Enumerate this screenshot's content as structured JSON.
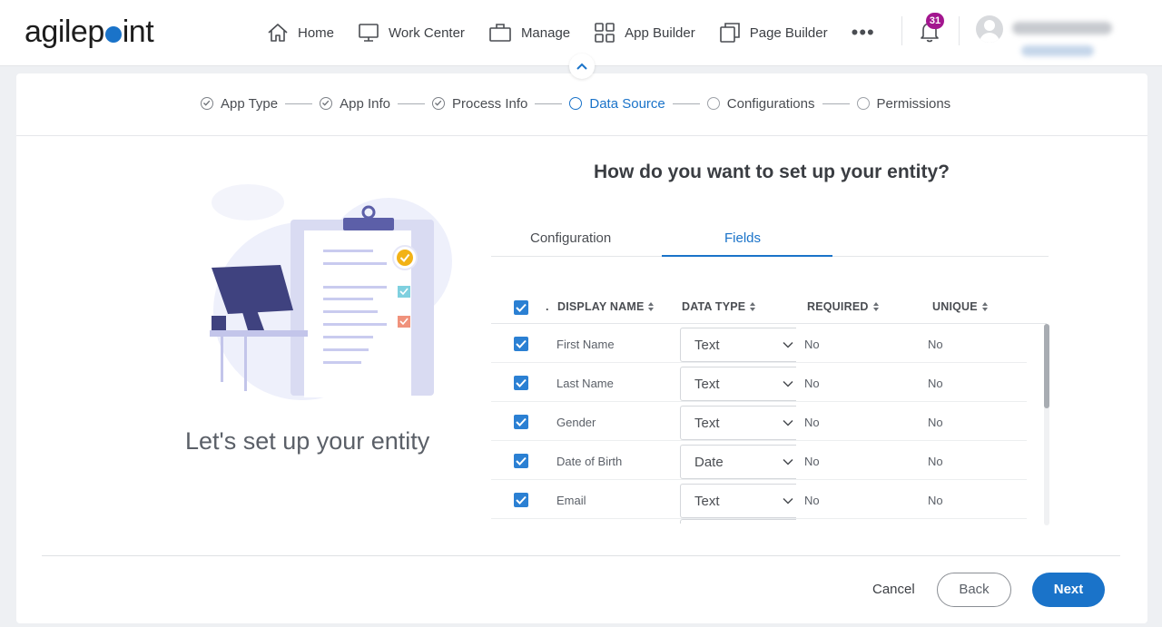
{
  "brand": {
    "logo_pre": "agilep",
    "logo_post": "int",
    "accent": "#1a73c9"
  },
  "nav": {
    "items": [
      {
        "label": "Home",
        "icon": "home-icon"
      },
      {
        "label": "Work Center",
        "icon": "monitor-icon"
      },
      {
        "label": "Manage",
        "icon": "briefcase-icon"
      },
      {
        "label": "App Builder",
        "icon": "grid-icon"
      },
      {
        "label": "Page Builder",
        "icon": "pages-icon"
      }
    ],
    "more": "•••",
    "notifications": "31"
  },
  "steps": [
    {
      "label": "App Type",
      "state": "done"
    },
    {
      "label": "App Info",
      "state": "done"
    },
    {
      "label": "Process Info",
      "state": "done"
    },
    {
      "label": "Data Source",
      "state": "active"
    },
    {
      "label": "Configurations",
      "state": "todo"
    },
    {
      "label": "Permissions",
      "state": "todo"
    }
  ],
  "left": {
    "caption": "Let's set up your entity"
  },
  "main": {
    "heading": "How do you want to set up your entity?",
    "tabs": [
      {
        "label": "Configuration"
      },
      {
        "label": "Fields"
      }
    ],
    "columns": {
      "dot": ".",
      "display_name": "DISPLAY NAME",
      "data_type": "DATA TYPE",
      "required": "REQUIRED",
      "unique": "UNIQUE"
    },
    "rows": [
      {
        "name": "First Name",
        "type": "Text",
        "required": "No",
        "unique": "No"
      },
      {
        "name": "Last Name",
        "type": "Text",
        "required": "No",
        "unique": "No"
      },
      {
        "name": "Gender",
        "type": "Text",
        "required": "No",
        "unique": "No"
      },
      {
        "name": "Date of Birth",
        "type": "Date",
        "required": "No",
        "unique": "No"
      },
      {
        "name": "Email",
        "type": "Text",
        "required": "No",
        "unique": "No"
      }
    ]
  },
  "footer": {
    "cancel": "Cancel",
    "back": "Back",
    "next": "Next"
  }
}
